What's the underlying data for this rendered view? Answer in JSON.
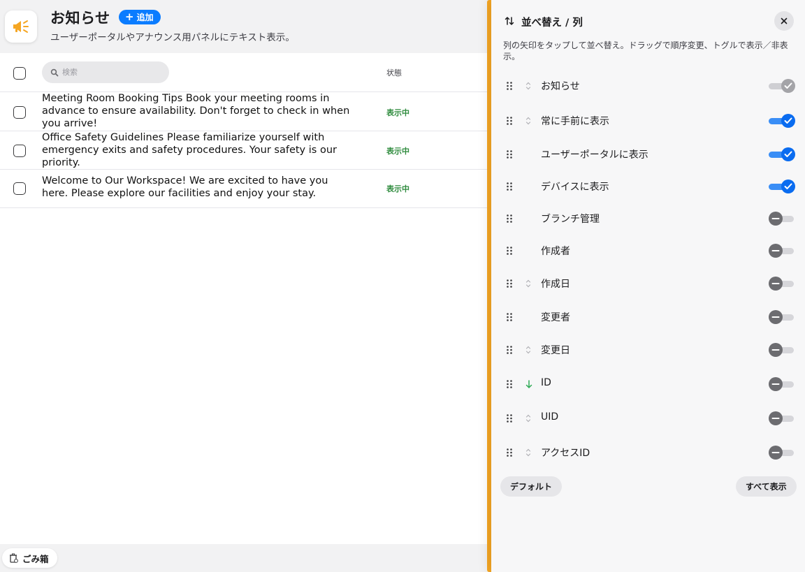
{
  "header": {
    "title": "お知らせ",
    "add_label": "追加",
    "subtitle": "ユーザーポータルやアナウンス用パネルにテキスト表示。",
    "accent_color": "#f5a623",
    "icon": "megaphone-icon"
  },
  "table": {
    "search_placeholder": "検索",
    "status_header": "状態",
    "rows": [
      {
        "text": "Meeting Room Booking Tips Book your meeting rooms in advance to ensure availability. Don't forget to check in when you arrive!",
        "status": "表示中"
      },
      {
        "text": "Office Safety Guidelines Please familiarize yourself with emergency exits and safety procedures. Your safety is our priority.",
        "status": "表示中"
      },
      {
        "text": "Welcome to Our Workspace! We are excited to have you here. Please explore our facilities and enjoy your stay.",
        "status": "表示中"
      }
    ]
  },
  "trash": {
    "label": "ごみ箱"
  },
  "panel": {
    "title": "並べ替え / 列",
    "description": "列の矢印をタップして並べ替え。ドラッグで順序変更、トグルで表示／非表示。",
    "columns": [
      {
        "label": "お知らせ",
        "sort": "both",
        "state": "locked"
      },
      {
        "label": "常に手前に表示",
        "sort": "both",
        "state": "on"
      },
      {
        "label": "ユーザーポータルに表示",
        "sort": "none",
        "state": "on"
      },
      {
        "label": "デバイスに表示",
        "sort": "none",
        "state": "on"
      },
      {
        "label": "ブランチ管理",
        "sort": "none",
        "state": "off"
      },
      {
        "label": "作成者",
        "sort": "none",
        "state": "off"
      },
      {
        "label": "作成日",
        "sort": "both",
        "state": "off"
      },
      {
        "label": "変更者",
        "sort": "none",
        "state": "off"
      },
      {
        "label": "変更日",
        "sort": "both",
        "state": "off"
      },
      {
        "label": "ID",
        "sort": "desc",
        "state": "off"
      },
      {
        "label": "UID",
        "sort": "both",
        "state": "off"
      },
      {
        "label": "アクセスID",
        "sort": "both",
        "state": "off"
      }
    ],
    "default_label": "デフォルト",
    "show_all_label": "すべて表示"
  }
}
